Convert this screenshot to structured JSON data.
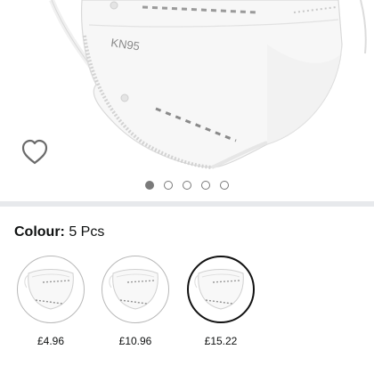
{
  "product": {
    "mask_print": "KN95"
  },
  "gallery": {
    "dot_count": 5,
    "active_index": 0
  },
  "colour": {
    "label": "Colour:",
    "selected_value": "5 Pcs"
  },
  "options": [
    {
      "price": "£4.96",
      "selected": false
    },
    {
      "price": "£10.96",
      "selected": false
    },
    {
      "price": "£15.22",
      "selected": true
    }
  ],
  "icons": {
    "wishlist": "heart-outline-icon"
  },
  "colors": {
    "divider": "#e7e9ec",
    "selected_border": "#111111",
    "dot": "#7a7a7a"
  }
}
